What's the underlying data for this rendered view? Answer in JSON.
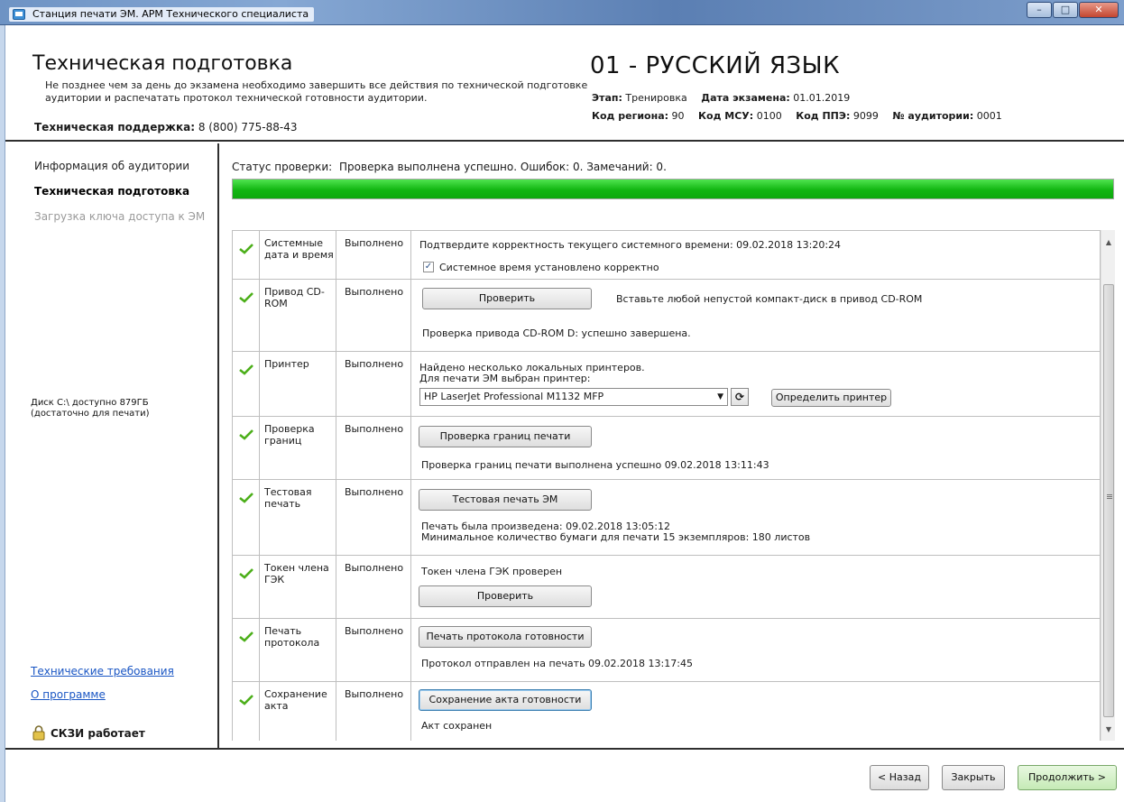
{
  "window": {
    "title": "Станция печати ЭМ. АРМ Технического специалиста",
    "buttons": [
      "minimize",
      "maximize",
      "close"
    ]
  },
  "header": {
    "title": "Техническая подготовка",
    "note": "Не позднее чем за день до экзамена необходимо завершить все действия по технической подготовке аудитории и распечатать протокол технической готовности аудитории.",
    "support_label": "Техническая поддержка:",
    "support_value": "8 (800) 775-88-43",
    "subject": "01 - РУССКИЙ ЯЗЫК",
    "stage_label": "Этап:",
    "stage_value": "Тренировка",
    "date_label": "Дата экзамена:",
    "date_value": "01.01.2019",
    "region_label": "Код региона:",
    "region_value": "90",
    "msu_label": "Код МСУ:",
    "msu_value": "0100",
    "ppe_label": "Код ППЭ:",
    "ppe_value": "9099",
    "room_label": "№ аудитории:",
    "room_value": "0001"
  },
  "sidebar": {
    "items": [
      {
        "label": "Информация об аудитории",
        "state": "normal"
      },
      {
        "label": "Техническая подготовка",
        "state": "active"
      },
      {
        "label": "Загрузка ключа доступа к ЭМ",
        "state": "disabled"
      }
    ],
    "disk_line1": "Диск C:\\ доступно 879ГБ",
    "disk_line2": "(достаточно для печати)",
    "link_requirements": "Технические требования",
    "link_about": "О программе",
    "skzi_status": "СКЗИ работает"
  },
  "main": {
    "status_label": "Статус проверки:",
    "status_text": "Проверка выполнена успешно. Ошибок: 0. Замечаний: 0.",
    "progress_fraction": 1.0,
    "progress_color": "#12b612"
  },
  "checks": [
    {
      "name": "Системные дата и время",
      "status": "Выполнено",
      "message": "Подтвердите корректность текущего системного времени: 09.02.2018 13:20:24",
      "checkbox_label": "Системное время установлено корректно",
      "checkbox_checked": true
    },
    {
      "name": "Привод CD-ROM",
      "status": "Выполнено",
      "button": "Проверить",
      "hint": "Вставьте любой непустой компакт-диск в привод CD-ROM",
      "result": "Проверка привода CD-ROM D: успешно завершена."
    },
    {
      "name": "Принтер",
      "status": "Выполнено",
      "message1": "Найдено несколько локальных принтеров.",
      "message2": "Для печати ЭМ выбран принтер:",
      "printer_selected": "HP LaserJet Professional M1132 MFP",
      "detect_button": "Определить принтер"
    },
    {
      "name": "Проверка границ",
      "status": "Выполнено",
      "button": "Проверка границ печати",
      "result": "Проверка границ печати выполнена успешно 09.02.2018 13:11:43"
    },
    {
      "name": "Тестовая печать",
      "status": "Выполнено",
      "button": "Тестовая печать ЭМ",
      "result1": "Печать была произведена: 09.02.2018 13:05:12",
      "result2": "Минимальное количество бумаги для печати 15 экземпляров: 180 листов"
    },
    {
      "name": "Токен члена ГЭК",
      "status": "Выполнено",
      "message": "Токен члена ГЭК проверен",
      "button": "Проверить"
    },
    {
      "name": "Печать протокола",
      "status": "Выполнено",
      "button": "Печать протокола готовности",
      "result": "Протокол отправлен на печать 09.02.2018 13:17:45"
    },
    {
      "name": "Сохранение акта",
      "status": "Выполнено",
      "button": "Сохранение акта готовности",
      "result": "Акт сохранен"
    }
  ],
  "footer": {
    "back": "< Назад",
    "close": "Закрыть",
    "continue": "Продолжить >"
  },
  "colors": {
    "check_green": "#4caf1a",
    "link_blue": "#1a56c4",
    "primary_button": "#c5eab6"
  }
}
